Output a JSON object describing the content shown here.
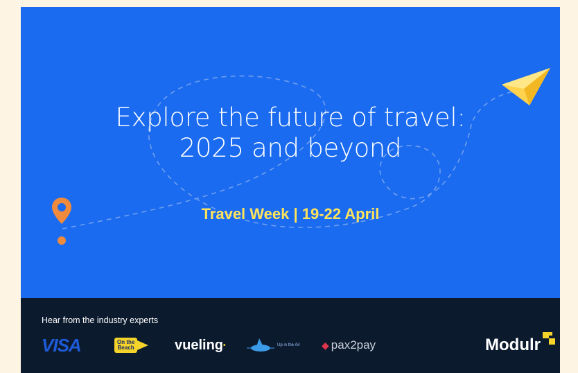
{
  "hero": {
    "title_line1": "Explore the future of travel:",
    "title_line2": "2025 and beyond",
    "event_line": "Travel Week | 19-22 April",
    "background_color": "#1a6bf0",
    "accent_color": "#ffe45a",
    "icons": [
      "location-pin-icon",
      "paper-plane-icon"
    ]
  },
  "footer": {
    "label": "Hear from the industry experts",
    "logos": {
      "visa": "VISA",
      "beach_top": "On the",
      "beach_bottom": "Beach",
      "vueling": "vueling",
      "upintheair": "Up in the Air",
      "pax2pay": "pax2pay",
      "modulr": "Modulr"
    },
    "background_color": "#0c1a2e"
  }
}
